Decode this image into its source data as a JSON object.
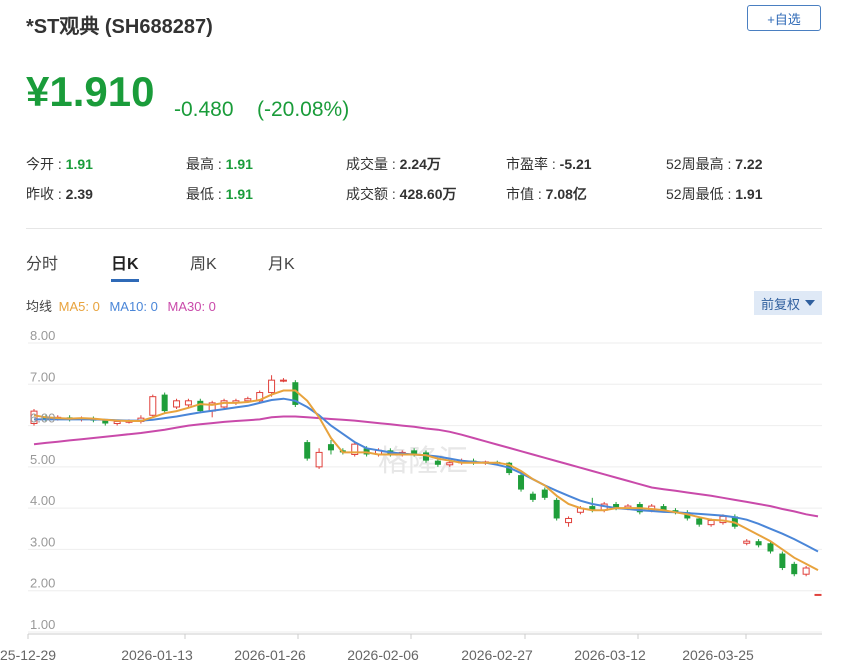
{
  "header": {
    "title": "*ST观典 (SH688287)",
    "watch_button": "+自选",
    "price": "¥1.910",
    "change": "-0.480",
    "change_pct": "(-20.08%)"
  },
  "stats": {
    "open": {
      "label": "今开 :",
      "value": "1.91"
    },
    "prev_close": {
      "label": "昨收 :",
      "value": "2.39"
    },
    "high": {
      "label": "最高 :",
      "value": "1.91"
    },
    "low": {
      "label": "最低 :",
      "value": "1.91"
    },
    "volume": {
      "label": "成交量 :",
      "value": "2.24万"
    },
    "turnover": {
      "label": "成交额 :",
      "value": "428.60万"
    },
    "pe": {
      "label": "市盈率 :",
      "value": "-5.21"
    },
    "market_cap": {
      "label": "市值 :",
      "value": "7.08亿"
    },
    "high_52w": {
      "label": "52周最高 :",
      "value": "7.22"
    },
    "low_52w": {
      "label": "52周最低 :",
      "value": "1.91"
    }
  },
  "tabs": [
    {
      "label": "分时",
      "active": false
    },
    {
      "label": "日K",
      "active": true
    },
    {
      "label": "周K",
      "active": false
    },
    {
      "label": "月K",
      "active": false
    }
  ],
  "ma_legend": {
    "label": "均线",
    "ma5": "MA5: 0",
    "ma10": "MA10: 0",
    "ma30": "MA30: 0"
  },
  "adjust_button": "前复权",
  "watermark": "格隆汇",
  "colors": {
    "up": "#e0413c",
    "down": "#1f9e3a",
    "ma5": "#e8a33d",
    "ma10": "#4a86d8",
    "ma30": "#c94aaa",
    "accent": "#2f6ab7"
  },
  "chart_data": {
    "type": "candlestick",
    "ylim": [
      1.0,
      8.0
    ],
    "y_ticks": [
      "8.00",
      "7.00",
      "6.00",
      "5.00",
      "4.00",
      "3.00",
      "2.00",
      "1.00"
    ],
    "x_ticks": [
      "25-12-29",
      "2026-01-13",
      "2026-01-26",
      "2026-02-06",
      "2026-02-27",
      "2026-03-12",
      "2026-03-25"
    ],
    "candles": [
      {
        "o": 6.05,
        "c": 6.35,
        "h": 6.4,
        "l": 6.0
      },
      {
        "o": 6.2,
        "c": 6.15,
        "h": 6.25,
        "l": 6.1
      },
      {
        "o": 6.15,
        "c": 6.2,
        "h": 6.25,
        "l": 6.12
      },
      {
        "o": 6.2,
        "c": 6.15,
        "h": 6.25,
        "l": 6.1
      },
      {
        "o": 6.15,
        "c": 6.18,
        "h": 6.22,
        "l": 6.1
      },
      {
        "o": 6.18,
        "c": 6.12,
        "h": 6.22,
        "l": 6.08
      },
      {
        "o": 6.12,
        "c": 6.05,
        "h": 6.15,
        "l": 6.0
      },
      {
        "o": 6.05,
        "c": 6.1,
        "h": 6.12,
        "l": 6.0
      },
      {
        "o": 6.08,
        "c": 6.12,
        "h": 6.15,
        "l": 6.05
      },
      {
        "o": 6.1,
        "c": 6.18,
        "h": 6.25,
        "l": 6.05
      },
      {
        "o": 6.25,
        "c": 6.7,
        "h": 6.75,
        "l": 6.2
      },
      {
        "o": 6.75,
        "c": 6.35,
        "h": 6.8,
        "l": 6.3
      },
      {
        "o": 6.45,
        "c": 6.6,
        "h": 6.65,
        "l": 6.4
      },
      {
        "o": 6.5,
        "c": 6.6,
        "h": 6.65,
        "l": 6.45
      },
      {
        "o": 6.6,
        "c": 6.35,
        "h": 6.65,
        "l": 6.3
      },
      {
        "o": 6.35,
        "c": 6.55,
        "h": 6.6,
        "l": 6.2
      },
      {
        "o": 6.45,
        "c": 6.6,
        "h": 6.65,
        "l": 6.4
      },
      {
        "o": 6.55,
        "c": 6.6,
        "h": 6.65,
        "l": 6.5
      },
      {
        "o": 6.6,
        "c": 6.65,
        "h": 6.7,
        "l": 6.55
      },
      {
        "o": 6.6,
        "c": 6.8,
        "h": 6.85,
        "l": 6.55
      },
      {
        "o": 6.8,
        "c": 7.1,
        "h": 7.22,
        "l": 6.7
      },
      {
        "o": 7.1,
        "c": 7.1,
        "h": 7.15,
        "l": 7.05
      },
      {
        "o": 7.05,
        "c": 6.5,
        "h": 7.1,
        "l": 6.45
      },
      {
        "o": 5.6,
        "c": 5.2,
        "h": 5.65,
        "l": 5.15
      },
      {
        "o": 5.0,
        "c": 5.35,
        "h": 5.45,
        "l": 4.95
      },
      {
        "o": 5.55,
        "c": 5.4,
        "h": 5.65,
        "l": 5.3
      },
      {
        "o": 5.4,
        "c": 5.35,
        "h": 5.45,
        "l": 5.3
      },
      {
        "o": 5.3,
        "c": 5.55,
        "h": 5.6,
        "l": 5.25
      },
      {
        "o": 5.45,
        "c": 5.3,
        "h": 5.5,
        "l": 5.25
      },
      {
        "o": 5.3,
        "c": 5.4,
        "h": 5.45,
        "l": 5.25
      },
      {
        "o": 5.4,
        "c": 5.3,
        "h": 5.45,
        "l": 5.25
      },
      {
        "o": 5.3,
        "c": 5.35,
        "h": 5.4,
        "l": 5.25
      },
      {
        "o": 5.4,
        "c": 5.3,
        "h": 5.45,
        "l": 5.25
      },
      {
        "o": 5.35,
        "c": 5.15,
        "h": 5.4,
        "l": 5.1
      },
      {
        "o": 5.15,
        "c": 5.05,
        "h": 5.2,
        "l": 5.0
      },
      {
        "o": 5.05,
        "c": 5.1,
        "h": 5.15,
        "l": 5.0
      },
      {
        "o": 5.1,
        "c": 5.15,
        "h": 5.2,
        "l": 5.05
      },
      {
        "o": 5.15,
        "c": 5.1,
        "h": 5.2,
        "l": 5.05
      },
      {
        "o": 5.1,
        "c": 5.12,
        "h": 5.15,
        "l": 5.05
      },
      {
        "o": 5.12,
        "c": 5.1,
        "h": 5.15,
        "l": 5.05
      },
      {
        "o": 5.1,
        "c": 4.85,
        "h": 5.12,
        "l": 4.8
      },
      {
        "o": 4.8,
        "c": 4.45,
        "h": 4.85,
        "l": 4.4
      },
      {
        "o": 4.35,
        "c": 4.2,
        "h": 4.4,
        "l": 4.15
      },
      {
        "o": 4.45,
        "c": 4.25,
        "h": 4.5,
        "l": 4.2
      },
      {
        "o": 4.2,
        "c": 3.75,
        "h": 4.25,
        "l": 3.7
      },
      {
        "o": 3.65,
        "c": 3.75,
        "h": 3.8,
        "l": 3.55
      },
      {
        "o": 3.9,
        "c": 4.0,
        "h": 4.05,
        "l": 3.85
      },
      {
        "o": 4.05,
        "c": 3.95,
        "h": 4.25,
        "l": 3.9
      },
      {
        "o": 3.95,
        "c": 4.1,
        "h": 4.15,
        "l": 3.9
      },
      {
        "o": 4.1,
        "c": 4.0,
        "h": 4.15,
        "l": 3.95
      },
      {
        "o": 4.0,
        "c": 4.05,
        "h": 4.1,
        "l": 3.95
      },
      {
        "o": 4.1,
        "c": 3.9,
        "h": 4.15,
        "l": 3.85
      },
      {
        "o": 3.95,
        "c": 4.05,
        "h": 4.1,
        "l": 3.9
      },
      {
        "o": 4.05,
        "c": 3.95,
        "h": 4.1,
        "l": 3.9
      },
      {
        "o": 3.95,
        "c": 3.9,
        "h": 4.0,
        "l": 3.85
      },
      {
        "o": 3.9,
        "c": 3.75,
        "h": 3.95,
        "l": 3.7
      },
      {
        "o": 3.75,
        "c": 3.6,
        "h": 3.8,
        "l": 3.55
      },
      {
        "o": 3.6,
        "c": 3.7,
        "h": 3.75,
        "l": 3.55
      },
      {
        "o": 3.65,
        "c": 3.8,
        "h": 3.85,
        "l": 3.6
      },
      {
        "o": 3.8,
        "c": 3.55,
        "h": 3.85,
        "l": 3.5
      },
      {
        "o": 3.15,
        "c": 3.2,
        "h": 3.25,
        "l": 3.1
      },
      {
        "o": 3.2,
        "c": 3.1,
        "h": 3.25,
        "l": 3.05
      },
      {
        "o": 3.15,
        "c": 2.95,
        "h": 3.2,
        "l": 2.9
      },
      {
        "o": 2.9,
        "c": 2.55,
        "h": 2.95,
        "l": 2.5
      },
      {
        "o": 2.65,
        "c": 2.4,
        "h": 2.7,
        "l": 2.35
      },
      {
        "o": 2.4,
        "c": 2.55,
        "h": 2.6,
        "l": 2.35
      },
      {
        "o": 1.91,
        "c": 1.91,
        "h": 1.91,
        "l": 1.91
      }
    ],
    "ma5": [
      6.25,
      6.2,
      6.18,
      6.17,
      6.18,
      6.17,
      6.14,
      6.12,
      6.11,
      6.11,
      6.2,
      6.3,
      6.35,
      6.43,
      6.52,
      6.5,
      6.55,
      6.55,
      6.57,
      6.62,
      6.75,
      6.85,
      6.85,
      6.6,
      6.2,
      5.7,
      5.35,
      5.35,
      5.35,
      5.3,
      5.3,
      5.3,
      5.3,
      5.28,
      5.2,
      5.15,
      5.1,
      5.1,
      5.1,
      5.1,
      5.05,
      4.9,
      4.7,
      4.55,
      4.3,
      4.1,
      4.0,
      3.95,
      3.95,
      4.0,
      4.0,
      4.0,
      3.98,
      3.95,
      3.9,
      3.85,
      3.78,
      3.72,
      3.7,
      3.65,
      3.5,
      3.35,
      3.2,
      3.0,
      2.8,
      2.65,
      2.5
    ],
    "ma10": [
      6.15,
      6.15,
      6.15,
      6.15,
      6.15,
      6.15,
      6.14,
      6.13,
      6.12,
      6.12,
      6.14,
      6.18,
      6.22,
      6.27,
      6.32,
      6.36,
      6.4,
      6.44,
      6.48,
      6.55,
      6.62,
      6.65,
      6.6,
      6.45,
      6.25,
      6.0,
      5.8,
      5.6,
      5.45,
      5.4,
      5.35,
      5.32,
      5.3,
      5.28,
      5.25,
      5.2,
      5.15,
      5.12,
      5.1,
      5.05,
      4.98,
      4.85,
      4.7,
      4.55,
      4.42,
      4.3,
      4.18,
      4.1,
      4.05,
      4.0,
      3.98,
      3.95,
      3.93,
      3.91,
      3.9,
      3.88,
      3.86,
      3.84,
      3.82,
      3.78,
      3.72,
      3.62,
      3.5,
      3.38,
      3.25,
      3.1,
      2.95
    ],
    "ma30": [
      5.55,
      5.58,
      5.61,
      5.64,
      5.67,
      5.7,
      5.73,
      5.76,
      5.79,
      5.82,
      5.86,
      5.9,
      5.95,
      6.0,
      6.03,
      6.06,
      6.09,
      6.11,
      6.13,
      6.15,
      6.2,
      6.22,
      6.22,
      6.2,
      6.18,
      6.16,
      6.14,
      6.12,
      6.09,
      6.06,
      6.03,
      6.0,
      5.97,
      5.93,
      5.9,
      5.85,
      5.78,
      5.7,
      5.62,
      5.54,
      5.46,
      5.38,
      5.3,
      5.22,
      5.14,
      5.06,
      4.98,
      4.9,
      4.82,
      4.74,
      4.66,
      4.58,
      4.5,
      4.46,
      4.42,
      4.38,
      4.34,
      4.3,
      4.25,
      4.2,
      4.15,
      4.1,
      4.05,
      3.98,
      3.92,
      3.85,
      3.8
    ]
  }
}
